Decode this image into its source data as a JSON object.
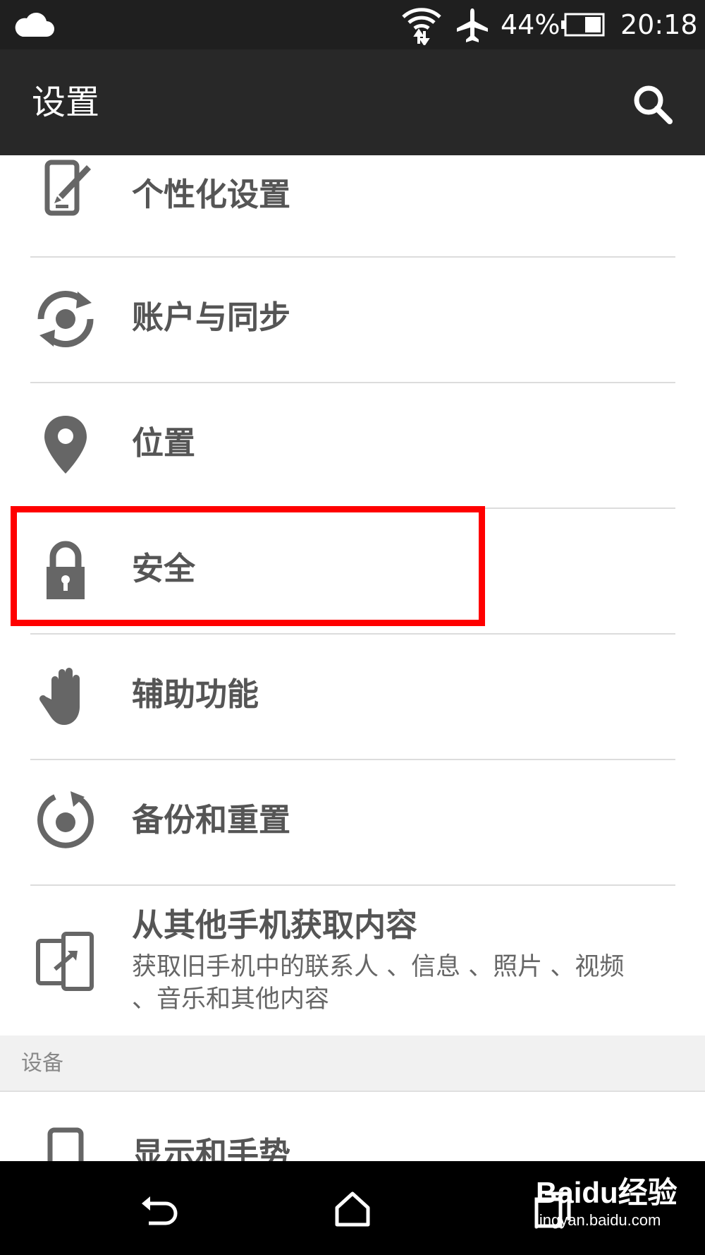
{
  "status_bar": {
    "battery_percent": "44%",
    "time": "20:18"
  },
  "app_bar": {
    "title": "设置"
  },
  "items": [
    {
      "label": "个性化设置",
      "icon": "personalize-icon"
    },
    {
      "label": "账户与同步",
      "icon": "sync-icon"
    },
    {
      "label": "位置",
      "icon": "location-pin-icon"
    },
    {
      "label": "安全",
      "icon": "lock-icon"
    },
    {
      "label": "辅助功能",
      "icon": "hand-icon"
    },
    {
      "label": "备份和重置",
      "icon": "backup-reset-icon"
    },
    {
      "label": "从其他手机获取内容",
      "subtitle": "获取旧手机中的联系人 、信息 、照片 、视频 、音乐和其他内容",
      "icon": "transfer-icon"
    }
  ],
  "section": {
    "title": "设备"
  },
  "partial_item": {
    "label": "显示和手势",
    "icon": "phone-icon"
  },
  "watermark": {
    "brand": "Baidu经验",
    "url": "jingyan.baidu.com"
  },
  "colors": {
    "highlight": "#ff0000",
    "app_bar": "#282828",
    "icon": "#666666"
  }
}
